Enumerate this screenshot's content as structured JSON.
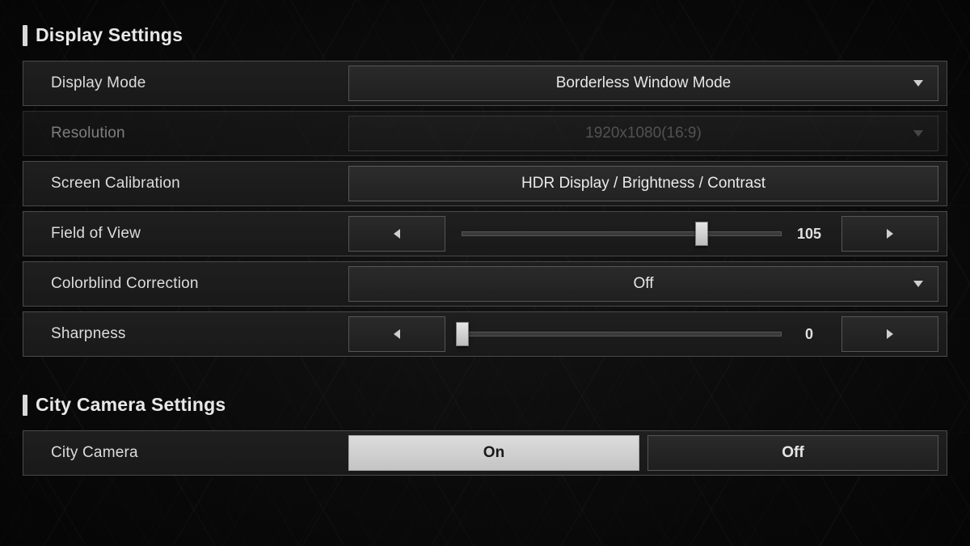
{
  "sections": {
    "display": {
      "title": "Display Settings",
      "rows": {
        "display_mode": {
          "label": "Display Mode",
          "value": "Borderless Window Mode"
        },
        "resolution": {
          "label": "Resolution",
          "value": "1920x1080(16:9)",
          "disabled": true
        },
        "calibration": {
          "label": "Screen Calibration",
          "value": "HDR Display / Brightness / Contrast"
        },
        "fov": {
          "label": "Field of View",
          "value": 105,
          "min": 60,
          "max": 120
        },
        "colorblind": {
          "label": "Colorblind Correction",
          "value": "Off"
        },
        "sharpness": {
          "label": "Sharpness",
          "value": 0,
          "min": 0,
          "max": 10
        }
      }
    },
    "camera": {
      "title": "City Camera Settings",
      "rows": {
        "city_camera": {
          "label": "City Camera",
          "value": "On",
          "options": [
            "On",
            "Off"
          ]
        }
      }
    }
  }
}
